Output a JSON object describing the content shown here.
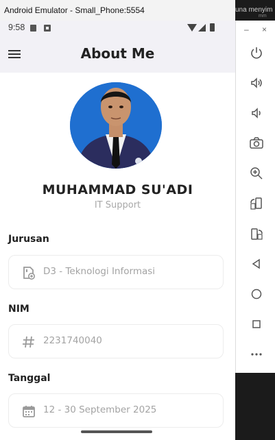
{
  "window": {
    "title": "Android Emulator - Small_Phone:5554",
    "behind_text": "una menyim",
    "behind_sub": "mm"
  },
  "status_bar": {
    "time": "9:58"
  },
  "app_bar": {
    "title": "About Me",
    "menu_icon": "hamburger-menu-icon"
  },
  "profile": {
    "name": "MUHAMMAD SU'ADI",
    "role": "IT Support"
  },
  "fields": [
    {
      "label": "Jurusan",
      "icon": "sd-card-icon",
      "value": "D3 - Teknologi Informasi"
    },
    {
      "label": "NIM",
      "icon": "hash-icon",
      "value": "2231740040"
    },
    {
      "label": "Tanggal",
      "icon": "calendar-icon",
      "value": "12 - 30 September 2025"
    }
  ],
  "emulator_toolbar": {
    "minimize": "–",
    "close": "×",
    "buttons": [
      "power-icon",
      "volume-up-icon",
      "volume-down-icon",
      "camera-icon",
      "zoom-icon",
      "rotate-left-icon",
      "rotate-right-icon",
      "back-icon",
      "home-icon",
      "overview-icon",
      "more-icon"
    ]
  },
  "colors": {
    "app_bar_bg": "#f2f1f6",
    "avatar_bg": "#1f6fd0",
    "text_primary": "#222222",
    "text_muted": "#a3a3a3"
  }
}
